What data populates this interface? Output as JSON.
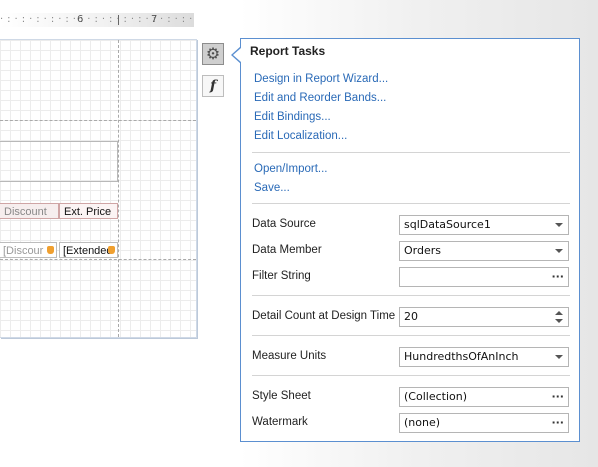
{
  "ruler": {
    "mark6": "6",
    "mark7": "7"
  },
  "designer": {
    "header_cells": [
      "Discount",
      "Ext. Price"
    ],
    "detail_cells": [
      "[Discour",
      "[Extended"
    ]
  },
  "smart_tags": {
    "tasks_icon": "gear-icon",
    "expressions_icon": "fx-icon"
  },
  "panel": {
    "title": "Report Tasks",
    "links": [
      "Design in Report Wizard...",
      "Edit and Reorder Bands...",
      "Edit Bindings...",
      "Edit Localization..."
    ],
    "file_links": [
      "Open/Import...",
      "Save..."
    ],
    "data_source": {
      "label": "Data Source",
      "value": "sqlDataSource1"
    },
    "data_member": {
      "label": "Data Member",
      "value": "Orders"
    },
    "filter_string": {
      "label": "Filter String",
      "value": ""
    },
    "detail_count": {
      "label": "Detail Count at Design Time",
      "value": "20"
    },
    "measure_units": {
      "label": "Measure Units",
      "value": "HundredthsOfAnInch"
    },
    "style_sheet": {
      "label": "Style Sheet",
      "value": "(Collection)"
    },
    "watermark": {
      "label": "Watermark",
      "value": "(none)"
    }
  },
  "colors": {
    "link": "#2a6ab7",
    "panel_border": "#5b8fd0"
  }
}
